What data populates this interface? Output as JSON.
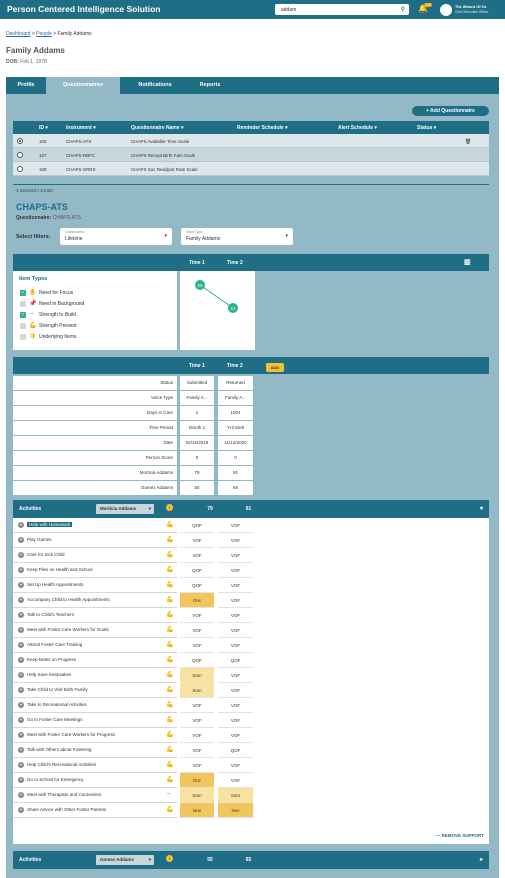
{
  "app": {
    "title": "Person Centered Intelligence Solution"
  },
  "search": {
    "value": "addam",
    "icon": "search-icon"
  },
  "notifications": {
    "count": "102"
  },
  "user": {
    "name": "The Wizard Of Oz",
    "role": "Chief Executive Officer"
  },
  "breadcrumb": {
    "items": [
      "Dashboard",
      "People",
      "Family Addams"
    ],
    "sep": ">"
  },
  "person": {
    "name": "Family Addams",
    "dob_label": "DOB:",
    "dob": "Feb 1, 1978"
  },
  "tabs": [
    {
      "label": "Profile",
      "active": false
    },
    {
      "label": "Questionnaires",
      "active": true
    },
    {
      "label": "Notifications",
      "active": false
    },
    {
      "label": "Reports",
      "active": false
    }
  ],
  "questionnaires": {
    "add_label": "+ Add Questionnaire",
    "columns": [
      "ID ▾",
      "Instrument ▾",
      "Questionnaire Name ▾",
      "Reminder Schedule ▾",
      "Alert Schedule ▾",
      "Status ▾"
    ],
    "rows": [
      {
        "id": "106",
        "instrument": "CHAPS-ATS",
        "name": "CHAPS Available Time Scale",
        "selected": true
      },
      {
        "id": "107",
        "instrument": "CHAPS-RBFC",
        "name": "CHAPS Recept Birth Fam Scale",
        "selected": false
      },
      {
        "id": "108",
        "instrument": "CHAPS-SRRS",
        "name": "CHAPS Soc Readjust Rate Scale",
        "selected": false
      }
    ],
    "footer": "1 selected / 3 total"
  },
  "detail": {
    "title": "CHAPS-ATS",
    "questionnaire_label": "Questionnaire:",
    "questionnaire_value": "CHAPS-ATS",
    "filters_label": "Select filters:",
    "filter1": {
      "label": "Collaboration",
      "value": "Lifetime"
    },
    "filter2": {
      "label": "Voice Type",
      "value": "Family Addams"
    }
  },
  "graph": {
    "time1": "Time 1",
    "time2": "Time 2",
    "legend_title": "Item Types",
    "legend": [
      {
        "label": "Need for Focus",
        "checked": true,
        "icon": "hand-icon"
      },
      {
        "label": "Need in Background",
        "checked": false,
        "icon": "pin-icon"
      },
      {
        "label": "Strength to Build",
        "checked": true,
        "icon": "arrows-icon"
      },
      {
        "label": "Strength Present",
        "checked": false,
        "icon": "arm-icon"
      },
      {
        "label": "Underlying Items",
        "checked": false,
        "icon": "shield-icon"
      }
    ],
    "node1": "20",
    "node2": "11"
  },
  "summary": {
    "time1": "Time 1",
    "time2": "Time 2",
    "add_label": "ADD",
    "rows": [
      {
        "label": "Status",
        "t1": "Submitted",
        "t2": "Returned"
      },
      {
        "label": "Voice Type",
        "t1": "Family A...",
        "t2": "Family A..."
      },
      {
        "label": "Days in Care",
        "t1": "1",
        "t2": "1004"
      },
      {
        "label": "Time Period",
        "t1": "Month 1",
        "t2": "Yr2 Mo9"
      },
      {
        "label": "Date",
        "t1": "02/15/2018",
        "t2": "11/14/2020"
      },
      {
        "label": "Person Score",
        "t1": "0",
        "t2": "0"
      },
      {
        "label": "Morticia Addams",
        "t1": "79",
        "t2": "91"
      },
      {
        "label": "Gomez Addams",
        "t1": "55",
        "t2": "65"
      }
    ]
  },
  "activities": {
    "label": "Activities",
    "person": "Morticia Addams",
    "t1": "79",
    "t2": "91",
    "warn": "!",
    "remove_label": "— REMOVE SUPPORT",
    "items": [
      {
        "name": "Help with Homework",
        "icon": "arm-icon",
        "t1": "QOF",
        "t2": "VOF",
        "hl": true
      },
      {
        "name": "Play Games",
        "icon": "arm-icon",
        "t1": "VOF",
        "t2": "VOF"
      },
      {
        "name": "Care for Sick Child",
        "icon": "arm-icon",
        "t1": "VOF",
        "t2": "VOF"
      },
      {
        "name": "Keep Files on Health and School",
        "icon": "arm-icon",
        "t1": "QOF",
        "t2": "VOF"
      },
      {
        "name": "Set Up Health Appointments",
        "icon": "arm-icon",
        "t1": "QOF",
        "t2": "VOF"
      },
      {
        "name": "Accompany Child to Health Appointments",
        "icon": "arm-icon",
        "t1": "Onc",
        "t2": "VOF",
        "c1": "orange"
      },
      {
        "name": "Talk to Child's Teachers",
        "icon": "arm-icon",
        "t1": "VOF",
        "t2": "VOF"
      },
      {
        "name": "Meet with Foster Care Workers for Goals",
        "icon": "arm-icon",
        "t1": "VOF",
        "t2": "VOF"
      },
      {
        "name": "Attend Foster Care Training",
        "icon": "arm-icon",
        "t1": "VOF",
        "t2": "VOF"
      },
      {
        "name": "Keep Notes on Progress",
        "icon": "arm-icon",
        "t1": "QOF",
        "t2": "QOF"
      },
      {
        "name": "Help Save Keepsakes",
        "icon": "arm-icon",
        "t1": "Som",
        "t2": "VOF",
        "c1": "yellow"
      },
      {
        "name": "Take Child to Visit Birth Family",
        "icon": "arm-icon",
        "t1": "Som",
        "t2": "VOF",
        "c1": "yellow"
      },
      {
        "name": "Take to Recreational Activities",
        "icon": "arm-icon",
        "t1": "VOF",
        "t2": "VOF"
      },
      {
        "name": "Go to Foster Care Meetings",
        "icon": "arm-icon",
        "t1": "VOF",
        "t2": "VOF"
      },
      {
        "name": "Meet with Foster Care Workers for Progress",
        "icon": "arm-icon",
        "t1": "VOF",
        "t2": "VOF"
      },
      {
        "name": "Talk with Others about Fostering",
        "icon": "arm-icon",
        "t1": "VOF",
        "t2": "QOF"
      },
      {
        "name": "Help Child's Recreational Activities",
        "icon": "arm-icon",
        "t1": "VOF",
        "t2": "VOF"
      },
      {
        "name": "Go to School for Emergency",
        "icon": "arm-icon",
        "t1": "Onc",
        "t2": "VOF",
        "c1": "orange"
      },
      {
        "name": "Meet with Therapists and Counselors",
        "icon": "arrows-icon",
        "t1": "Som",
        "t2": "Som",
        "c1": "yellow",
        "c2": "yellow"
      },
      {
        "name": "Share Advice with Other Foster Parents",
        "icon": "arm-icon",
        "t1": "Nov",
        "t2": "Nov",
        "c1": "orange",
        "c2": "orange"
      }
    ]
  },
  "activities2": {
    "label": "Activities",
    "person": "Gomez Addams",
    "t1": "55",
    "t2": "65",
    "warn": "!"
  },
  "colors": {
    "primary": "#1f6e86",
    "panel": "#93b8c6",
    "node": "#2bb38c",
    "yellow": "#f8e2a0",
    "orange": "#f2c55d"
  }
}
